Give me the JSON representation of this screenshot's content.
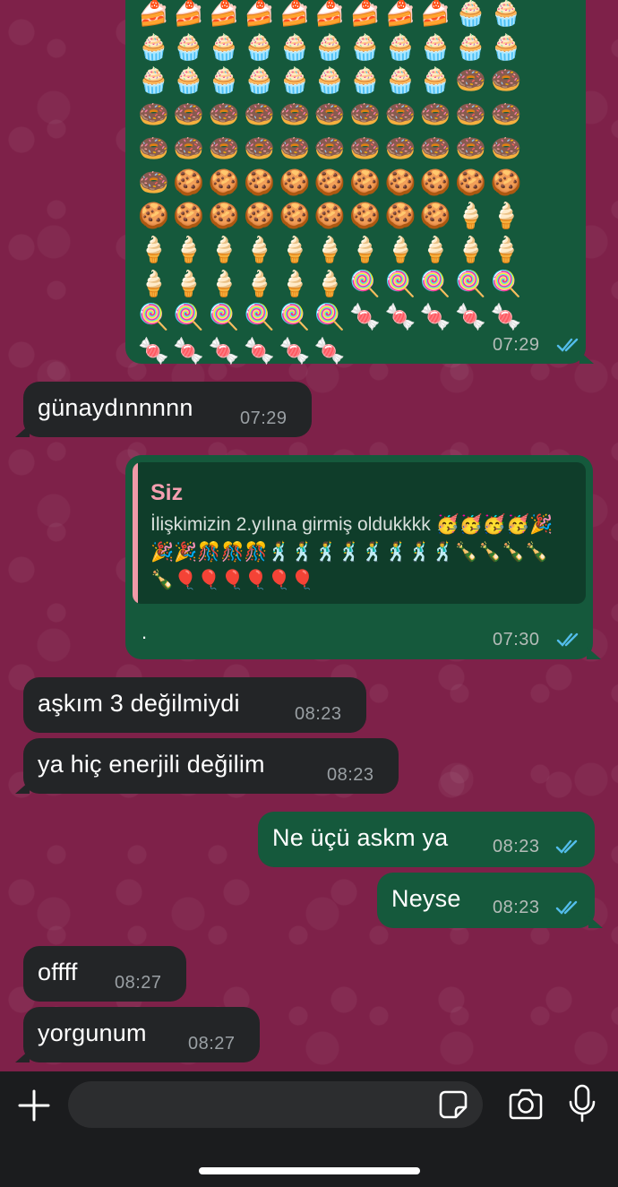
{
  "chat": {
    "messages": [
      {
        "direction": "outgoing",
        "text": "🍰🍰🍰🍰🍰🍰🍰🍰🍰🧁🧁🧁🧁🧁🧁🧁🧁🧁🧁🧁🧁🧁🧁🧁🧁🧁🧁🧁🧁🧁🧁🍩🍩🍩🍩🍩🍩🍩🍩🍩🍩🍩🍩🍩🍩🍩🍩🍩🍩🍩🍩🍩🍩🍩🍩🍩🍪🍪🍪🍪🍪🍪🍪🍪🍪🍪🍪🍪🍪🍪🍪🍪🍪🍪🍪🍦🍦🍦🍦🍦🍦🍦🍦🍦🍦🍦🍦🍦🍦🍦🍦🍦🍦🍦🍭🍭🍭🍭🍭🍭🍭🍭🍭🍭🍭🍬🍬🍬🍬🍬🍬🍬🍬🍬🍬🍬",
        "time": "07:29",
        "status": "read"
      },
      {
        "direction": "incoming",
        "text": "günaydınnnnn",
        "time": "07:29"
      },
      {
        "direction": "outgoing",
        "quote": {
          "sender": "Siz",
          "text": "İlişkimizin 2.yılına girmiş oldukkkk 🥳🥳🥳🥳🎉🎉🎉🎊🎊🎊🕺🕺🕺🕺🕺🕺🕺🕺🍾🍾🍾🍾🍾🎈🎈🎈🎈🎈🎈"
        },
        "text": ".",
        "time": "07:30",
        "status": "read"
      },
      {
        "direction": "incoming",
        "text": "aşkım 3 değilmiydi",
        "time": "08:23"
      },
      {
        "direction": "incoming",
        "text": "ya hiç enerjili değilim",
        "time": "08:23"
      },
      {
        "direction": "outgoing",
        "text": "Ne üçü askm ya",
        "time": "08:23",
        "status": "read"
      },
      {
        "direction": "outgoing",
        "text": "Neyse",
        "time": "08:23",
        "status": "read"
      },
      {
        "direction": "incoming",
        "text": "offff",
        "time": "08:27"
      },
      {
        "direction": "incoming",
        "text": "yorgunum",
        "time": "08:27"
      }
    ]
  },
  "composer": {
    "value": "",
    "placeholder": "",
    "icons": {
      "attach": "plus-icon",
      "sticker": "sticker-icon",
      "camera": "camera-icon",
      "mic": "microphone-icon"
    }
  },
  "colors": {
    "chat_background": "#7e2149",
    "outgoing_bubble": "#15593c",
    "incoming_bubble": "#232527",
    "quote_accent": "#f59fb0",
    "read_ticks": "#53bdeb",
    "composer_bar": "#1b1c1e"
  }
}
